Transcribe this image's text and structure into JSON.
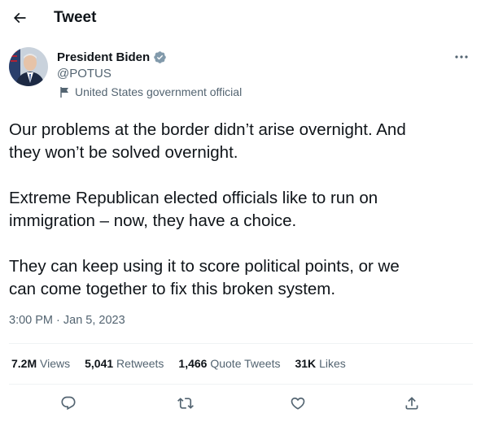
{
  "header": {
    "title": "Tweet",
    "back_icon": "arrow-left-icon"
  },
  "author": {
    "name": "President Biden",
    "handle": "@POTUS",
    "verified_icon": "verified-badge-icon",
    "label": "United States government official",
    "label_icon": "flag-icon"
  },
  "tweet": {
    "paragraphs": [
      "Our problems at the border didn’t arise overnight. And\nthey won’t be solved overnight.",
      "Extreme Republican elected officials like to run on\nimmigration – now, they have a choice.",
      "They can keep using it to score political points, or we\ncan come together to fix this broken system."
    ],
    "timestamp": "3:00 PM · Jan 5, 2023"
  },
  "stats": [
    {
      "value": "7.2M",
      "label": "Views"
    },
    {
      "value": "5,041",
      "label": "Retweets"
    },
    {
      "value": "1,466",
      "label": "Quote Tweets"
    },
    {
      "value": "31K",
      "label": "Likes"
    }
  ],
  "actions": [
    {
      "name": "reply",
      "icon": "reply-icon"
    },
    {
      "name": "retweet",
      "icon": "retweet-icon"
    },
    {
      "name": "like",
      "icon": "heart-icon"
    },
    {
      "name": "share",
      "icon": "share-icon"
    }
  ],
  "colors": {
    "text": "#0f1419",
    "secondary": "#536471",
    "verified": "#829aab",
    "divider": "#eff3f4"
  }
}
